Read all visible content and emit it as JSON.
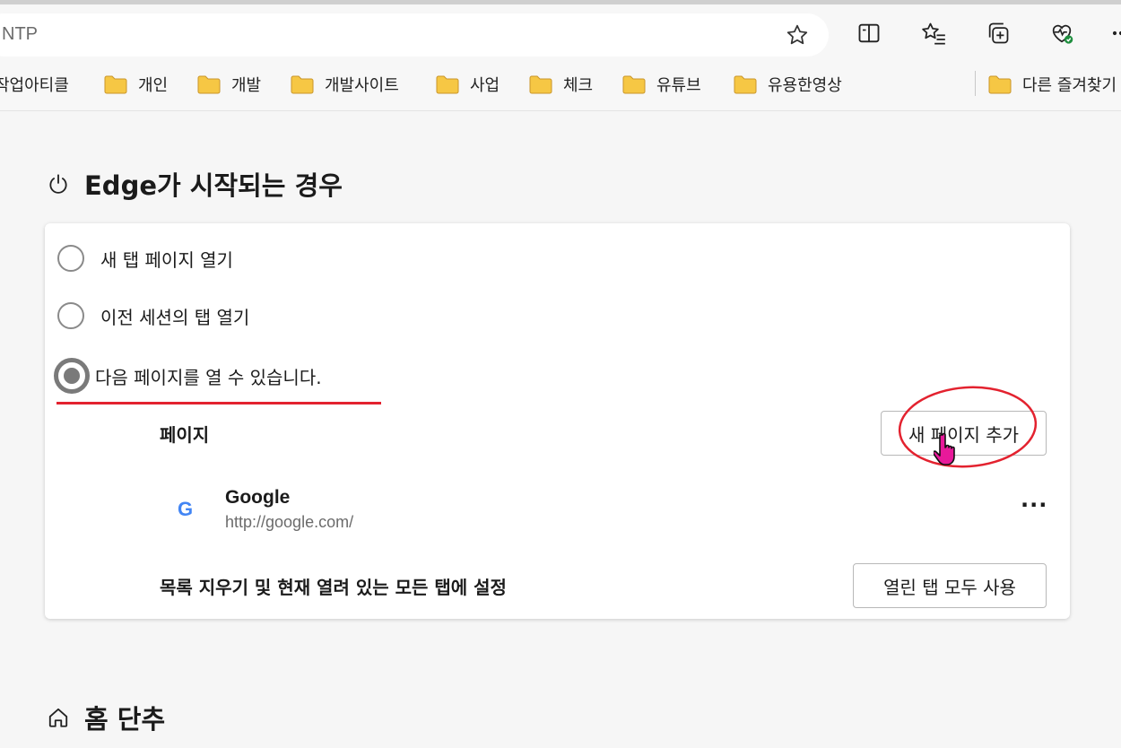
{
  "address_bar": {
    "text": "NTP"
  },
  "bookmarks": [
    {
      "label": "작업아티클"
    },
    {
      "label": "개인"
    },
    {
      "label": "개발"
    },
    {
      "label": "개발사이트"
    },
    {
      "label": "사업"
    },
    {
      "label": "체크"
    },
    {
      "label": "유튜브"
    },
    {
      "label": "유용한영상"
    }
  ],
  "other_favorites": {
    "label": "다른 즐겨찾기"
  },
  "startup": {
    "title": "Edge가 시작되는 경우",
    "options": [
      {
        "label": "새 탭 페이지 열기",
        "selected": false
      },
      {
        "label": "이전 세션의 탭 열기",
        "selected": false
      },
      {
        "label": "다음 페이지를 열 수 있습니다.",
        "selected": true
      }
    ],
    "pages_label": "페이지",
    "add_page_button": "새 페이지 추가",
    "pages": [
      {
        "logo": "G",
        "name": "Google",
        "url": "http://google.com/"
      }
    ],
    "more_label": "···",
    "clear_label": "목록 지우기 및 현재 열려 있는 모든 탭에 설정",
    "use_open_tabs_button": "열린 탭 모두 사용"
  },
  "home": {
    "title": "홈 단추"
  },
  "colors": {
    "accent_red": "#e3222f",
    "folder_yellow": "#f6c744"
  }
}
